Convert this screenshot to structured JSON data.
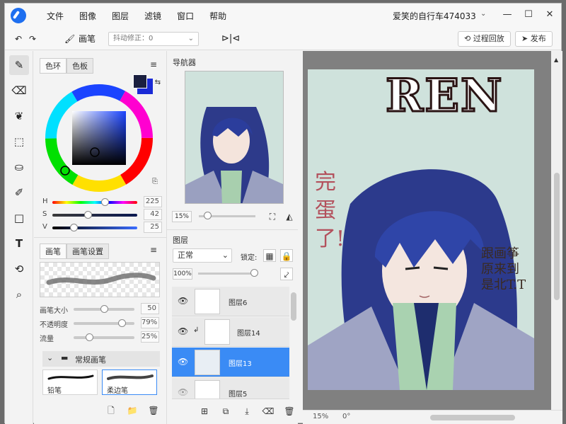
{
  "app": {
    "menu": [
      "文件",
      "图像",
      "图层",
      "滤镜",
      "窗口",
      "帮助"
    ],
    "doc_title": "爱笑的自行车474033",
    "window_controls": {
      "minimize": "—",
      "maximize": "☐",
      "close": "✕"
    }
  },
  "toolbar": {
    "tool_name": "画笔",
    "stabilizer_label": "抖动修正：0",
    "replay_label": "过程回放",
    "publish_label": "发布"
  },
  "tools": [
    "brush-icon",
    "eraser-icon",
    "smudge-icon",
    "selection-icon",
    "fill-bucket-icon",
    "eyedropper-icon",
    "shape-icon",
    "text-icon",
    "transform-icon",
    "zoom-icon"
  ],
  "color_panel": {
    "tabs": [
      "色环",
      "色板"
    ],
    "foreground": "#1b2040",
    "background": "#1a2ad6",
    "hsv": [
      {
        "label": "H",
        "value": "225",
        "fraction": 0.62
      },
      {
        "label": "S",
        "value": "42",
        "fraction": 0.42
      },
      {
        "label": "V",
        "value": "25",
        "fraction": 0.25
      }
    ]
  },
  "brush_panel": {
    "tabs": [
      "画笔",
      "画笔设置"
    ],
    "sliders": [
      {
        "label": "画笔大小",
        "value": "50",
        "fraction": 0.5
      },
      {
        "label": "不透明度",
        "value": "79%",
        "fraction": 0.79
      },
      {
        "label": "流量",
        "value": "25%",
        "fraction": 0.25
      }
    ],
    "group_name": "常规画笔",
    "presets": [
      "铅笔",
      "柔边笔"
    ]
  },
  "navigator": {
    "title": "导航器",
    "zoom": "15%"
  },
  "layers": {
    "title": "图层",
    "blend_mode": "正常",
    "lock_label": "锁定:",
    "opacity": "100%",
    "items": [
      {
        "name": "图层6",
        "selected": false
      },
      {
        "name": "图层14",
        "selected": false
      },
      {
        "name": "图层13",
        "selected": true
      },
      {
        "name": "图层5",
        "selected": false
      }
    ]
  },
  "artwork": {
    "title_text": "REN",
    "side_text": "完蛋了!",
    "caption_text": "跟画筝 原来到 是北T.T"
  },
  "status": {
    "zoom": "15%",
    "rotation": "0°"
  }
}
